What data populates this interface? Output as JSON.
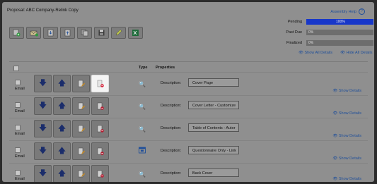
{
  "window": {
    "title": "Proposal: ABC Company-Relink Copy",
    "help_label": "Assembly Help",
    "help_icon": "?"
  },
  "toolbar": {
    "buttons": [
      {
        "name": "add-document-icon"
      },
      {
        "name": "email-icon"
      },
      {
        "name": "import-icon"
      },
      {
        "name": "export-icon"
      },
      {
        "name": "copy-icon"
      },
      {
        "name": "save-icon"
      },
      {
        "name": "edit-pencil-icon"
      },
      {
        "name": "excel-icon"
      }
    ]
  },
  "status": {
    "pending_label": "Pending",
    "pending_value": "100%",
    "pending_fraction": 1.0,
    "pastdue_label": "Past Due",
    "pastdue_value": "0%",
    "pastdue_fraction": 0.0,
    "finalized_label": "Finalized",
    "finalized_value": "0%",
    "finalized_fraction": 0.0,
    "bar_color": "#1737c9"
  },
  "links": {
    "show_all": "Show All Details",
    "hide_all": "Hide All Details"
  },
  "columns": {
    "type": "Type",
    "properties": "Properties"
  },
  "rows": [
    {
      "email": "Email",
      "type_icon": "search-icon",
      "desc_label": "Description:",
      "description": "Cover Page",
      "show_details": "Show Details"
    },
    {
      "email": "Email",
      "type_icon": "search-icon",
      "desc_label": "Description:",
      "description": "Cover Letter - Customize",
      "show_details": "Show Details"
    },
    {
      "email": "Email",
      "type_icon": "search-icon",
      "desc_label": "Description:",
      "description": "Table of Contents - Autor",
      "show_details": "Show Details"
    },
    {
      "email": "Email",
      "type_icon": "calendar-icon",
      "desc_label": "Description:",
      "description": "Questionnaire Only - Link",
      "show_details": "Show Details"
    },
    {
      "email": "Email",
      "type_icon": "search-icon",
      "desc_label": "Description:",
      "description": "Back Cover",
      "show_details": "Show Details"
    }
  ],
  "colors": {
    "link": "#1f4f9a",
    "accent_blue": "#1737c9",
    "overlay_gray": "#8f8f8f"
  }
}
